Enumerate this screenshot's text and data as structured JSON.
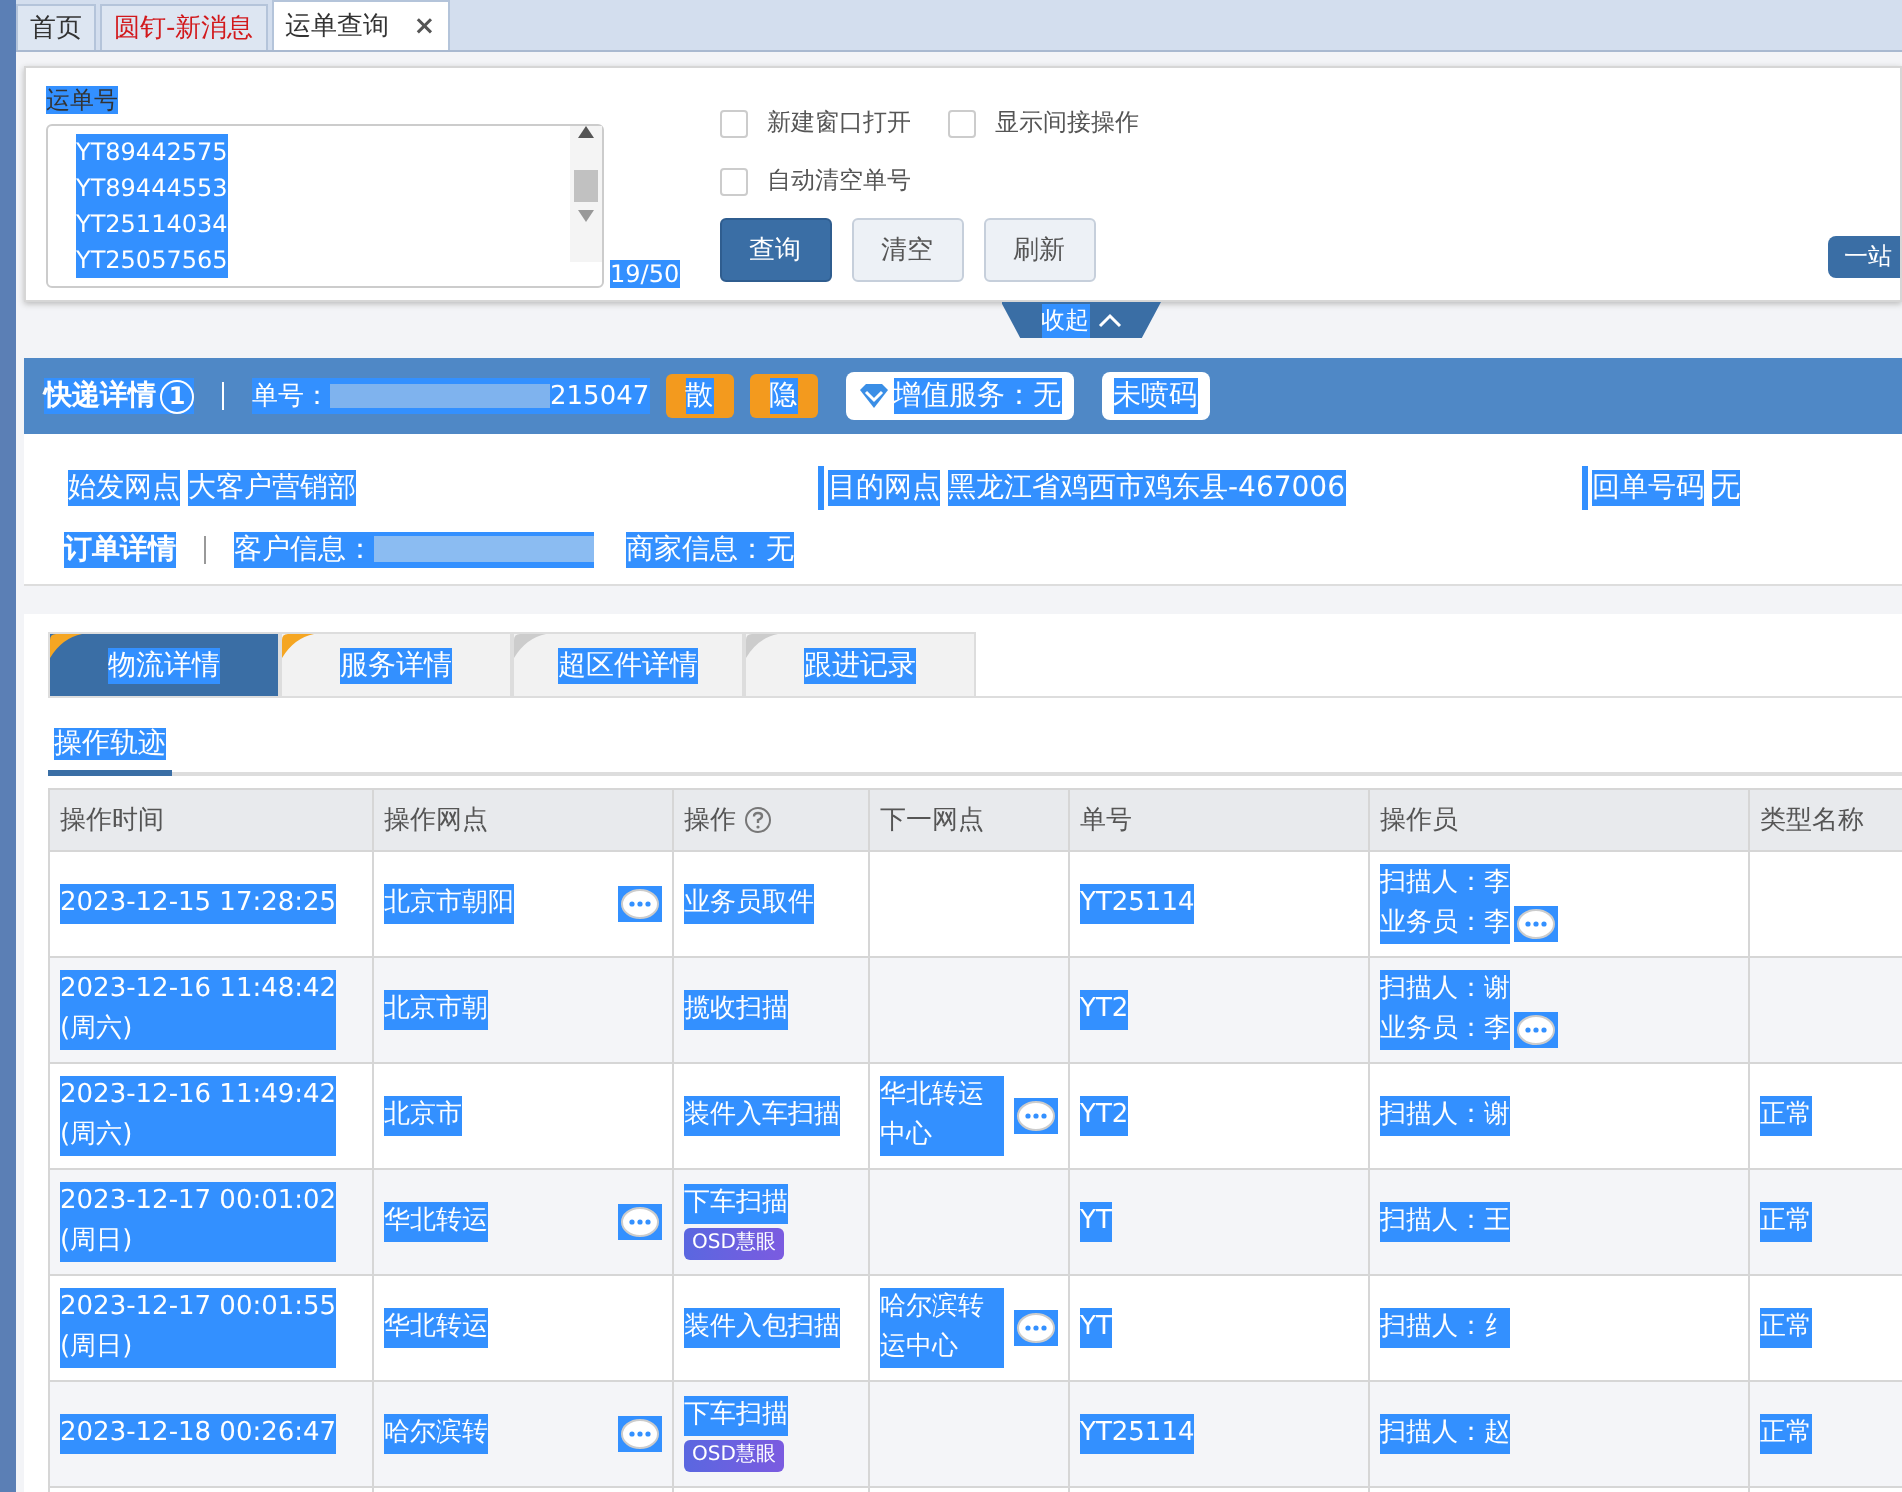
{
  "text_selected": true,
  "tabs": [
    {
      "label": "首页",
      "selected": false,
      "kind": "plain"
    },
    {
      "label": "圆钉-新消息",
      "selected": false,
      "kind": "alert"
    },
    {
      "label": "运单查询",
      "selected": true,
      "kind": "closable",
      "close": "×"
    }
  ],
  "query": {
    "label": "运单号",
    "numbers": [
      "YT89442575",
      "YT89444553",
      "YT25114034",
      "YT25057565"
    ],
    "count": "19/50",
    "options": [
      {
        "label": "新建窗口打开",
        "checked": false
      },
      {
        "label": "显示间接操作",
        "checked": false
      },
      {
        "label": "自动清空单号",
        "checked": false
      }
    ],
    "buttons": [
      {
        "label": "查询",
        "kind": "primary"
      },
      {
        "label": "清空",
        "kind": "plain"
      },
      {
        "label": "刷新",
        "kind": "plain"
      }
    ],
    "side_button": "一站",
    "collapse": "收起"
  },
  "express": {
    "title": "快递详情",
    "count": "1",
    "number_label": "单号：",
    "number": "215047",
    "tags": [
      "散",
      "隐"
    ],
    "service": "增值服务：无",
    "spray": "未喷码"
  },
  "info": [
    {
      "label": "始发网点",
      "value": "大客户营销部"
    },
    {
      "label": "目的网点",
      "value": "黑龙江省鸡西市鸡东县-467006"
    },
    {
      "label": "回单号码",
      "value": "无"
    }
  ],
  "order": {
    "title": "订单详情",
    "customer": "客户信息：",
    "merchant": "商家信息：无"
  },
  "detail_tabs": [
    {
      "label": "物流详情",
      "selected": true,
      "color": "#f5a623"
    },
    {
      "label": "服务详情",
      "selected": false,
      "color": "#f5a623"
    },
    {
      "label": "超区件详情",
      "selected": false,
      "color": "#cccccc"
    },
    {
      "label": "跟进记录",
      "selected": false,
      "color": "#cccccc"
    }
  ],
  "subtab": "操作轨迹",
  "table": {
    "columns": [
      "操作时间",
      "操作网点",
      "操作",
      "下一网点",
      "单号",
      "操作员",
      "类型名称"
    ],
    "rows": [
      {
        "time": "2023-12-15 17:28:25",
        "site": "北京市朝阳",
        "site_chat": true,
        "op": "业务员取件",
        "next": "",
        "next_chat": false,
        "number": "YT25114",
        "operators": [
          "扫描人：李",
          "业务员：李"
        ],
        "op_chat": true,
        "type": ""
      },
      {
        "time": "2023-12-16 11:48:42",
        "weekday": "(周六)",
        "site": "北京市朝",
        "site_chat": false,
        "op": "揽收扫描",
        "next": "",
        "next_chat": false,
        "number": "YT2",
        "operators": [
          "扫描人：谢",
          "业务员：李"
        ],
        "op_chat": true,
        "type": ""
      },
      {
        "time": "2023-12-16 11:49:42",
        "weekday": "(周六)",
        "site": "北京市",
        "site_chat": false,
        "op": "装件入车扫描",
        "next": "华北转运中心",
        "next_chat": true,
        "number": "YT2",
        "operators": [
          "扫描人：谢"
        ],
        "op_chat": false,
        "type": "正常"
      },
      {
        "time": "2023-12-17 00:01:02",
        "weekday": "(周日)",
        "site": "华北转运",
        "site_chat": true,
        "op": "下车扫描",
        "badge": "OSD慧眼",
        "next": "",
        "next_chat": false,
        "number": "YT",
        "operators": [
          "扫描人：王"
        ],
        "op_chat": false,
        "type": "正常"
      },
      {
        "time": "2023-12-17 00:01:55",
        "weekday": "(周日)",
        "site": "华北转运",
        "site_chat": false,
        "op": "装件入包扫描",
        "next": "哈尔滨转运中心",
        "next_chat": true,
        "number": "YT",
        "operators": [
          "扫描人：纟"
        ],
        "op_chat": false,
        "type": "正常"
      },
      {
        "time": "2023-12-18 00:26:47",
        "site": "哈尔滨转",
        "site_chat": true,
        "op": "下车扫描",
        "badge": "OSD慧眼",
        "next": "",
        "next_chat": false,
        "number": "YT25114",
        "operators": [
          "扫描人：赵"
        ],
        "op_chat": false,
        "type": "正常"
      }
    ]
  }
}
